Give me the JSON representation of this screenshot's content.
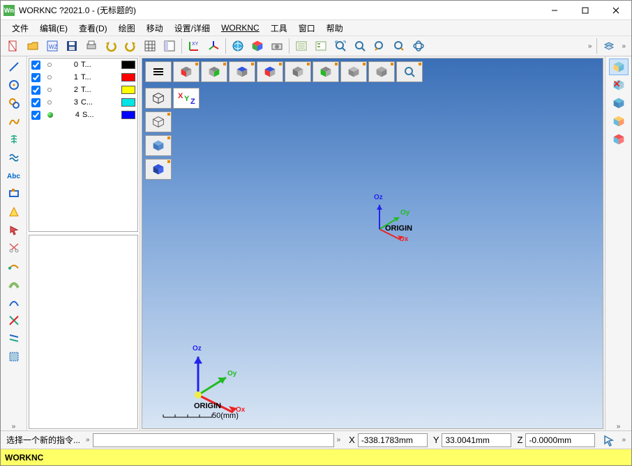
{
  "title": "WORKNC ?2021.0 - (无标题的)",
  "app_icon_text": "Wn",
  "menu": [
    "文件",
    "编辑(E)",
    "查看(D)",
    "绘图",
    "移动",
    "设置/详细",
    "WORKNC",
    "工具",
    "窗口",
    "帮助"
  ],
  "toolbar_icons": [
    "new-file",
    "open-file",
    "app-wz",
    "save",
    "print",
    "undo",
    "redo",
    "grid",
    "panel",
    "_sep_",
    "axes-xy",
    "axes-3d",
    "_sep_",
    "globe",
    "cube-colored",
    "camera",
    "_sep_",
    "list1",
    "list2",
    "zoom-all",
    "zoom-win",
    "zoom-prev",
    "zoom-next",
    "rotate"
  ],
  "left_tools": [
    "draw-line",
    "circle1",
    "circle2",
    "spline",
    "helix",
    "wave",
    "text",
    "rect",
    "hatch",
    "pick",
    "trim",
    "move",
    "blend",
    "arc",
    "cross",
    "lines",
    "select-rect"
  ],
  "right_tools": [
    "cube-blue",
    "cube-x",
    "cube-face",
    "cube-edge",
    "cube-red"
  ],
  "view_row": [
    "menu",
    "red",
    "green",
    "blue",
    "dual-rb",
    "gray1",
    "green2",
    "gray2",
    "gray3",
    "zoom"
  ],
  "view_col_labels": {
    "axes_x": "X",
    "axes_y": "Y",
    "axes_z": "Z"
  },
  "layers": [
    {
      "checked": true,
      "marker": "dot",
      "num": 0,
      "name": "T...",
      "color": "#000000"
    },
    {
      "checked": true,
      "marker": "dot",
      "num": 1,
      "name": "T...",
      "color": "#ff0000"
    },
    {
      "checked": true,
      "marker": "dot",
      "num": 2,
      "name": "T...",
      "color": "#ffff00"
    },
    {
      "checked": true,
      "marker": "dot",
      "num": 3,
      "name": "C...",
      "color": "#00e5e5"
    },
    {
      "checked": true,
      "marker": "ball",
      "num": 4,
      "name": "S...",
      "color": "#0000ff"
    }
  ],
  "gizmo_center": {
    "ox": "Ox",
    "oy": "Oy",
    "oz": "Oz",
    "origin": "ORIGIN"
  },
  "gizmo_corner": {
    "ox": "Ox",
    "oy": "Oy",
    "oz": "Oz",
    "origin": "ORIGIN",
    "scale": "50(mm)"
  },
  "prompt": "选择一个新的指令...",
  "chevron": "»",
  "axes": {
    "x_label": "X",
    "y_label": "Y",
    "z_label": "Z"
  },
  "coords": {
    "x": "-338.1783mm",
    "y": "33.0041mm",
    "z": "-0.0000mm"
  },
  "status": "WORKNC"
}
